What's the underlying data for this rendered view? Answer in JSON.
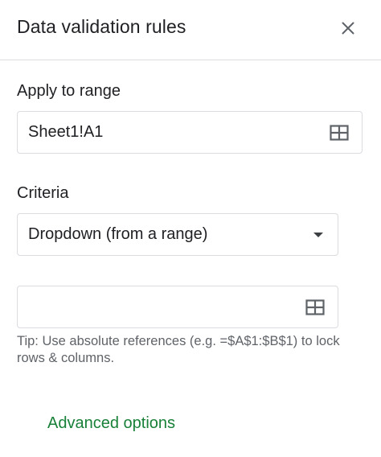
{
  "panel": {
    "title": "Data validation rules",
    "close_icon": "close-icon"
  },
  "apply_range": {
    "label": "Apply to range",
    "value": "Sheet1!A1",
    "icon": "grid-icon"
  },
  "criteria": {
    "label": "Criteria",
    "selected": "Dropdown (from a range)",
    "icon": "caret-down-icon"
  },
  "range_input": {
    "value": "",
    "icon": "grid-icon"
  },
  "tip": "Tip: Use absolute references (e.g. =$A$1:$B$1) to lock rows & columns.",
  "advanced_options": "Advanced options",
  "colors": {
    "accent_green": "#188038",
    "text": "#202124",
    "secondary_text": "#5f6368",
    "border": "#dadce0",
    "icon": "#5f6368"
  }
}
